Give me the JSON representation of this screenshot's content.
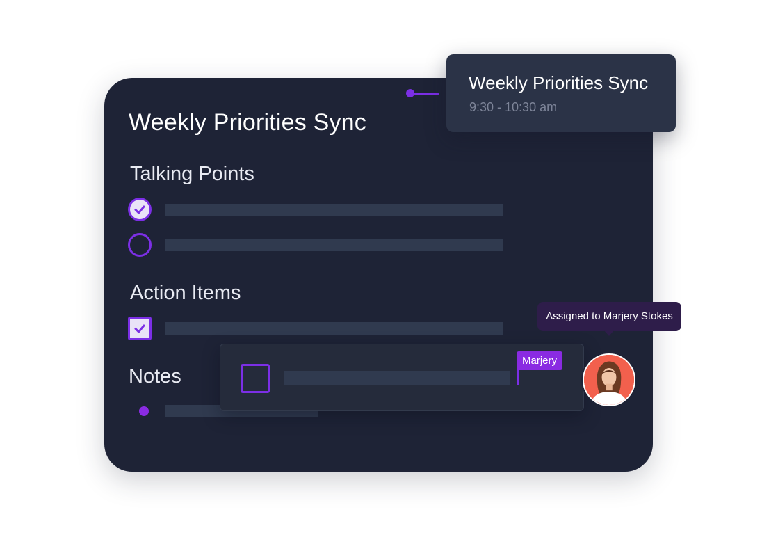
{
  "meeting": {
    "title": "Weekly Priorities Sync"
  },
  "sections": {
    "talking_points": "Talking Points",
    "action_items": "Action Items",
    "notes": "Notes"
  },
  "talking_points_items": [
    {
      "checked": true
    },
    {
      "checked": false
    }
  ],
  "action_items_list": [
    {
      "checked": true
    }
  ],
  "popup": {
    "title": "Weekly Priorities Sync",
    "time": "9:30 - 10:30 am"
  },
  "editor": {
    "cursor_label": "Marjery"
  },
  "assignment": {
    "tooltip": "Assigned to Marjery Stokes"
  },
  "colors": {
    "accent": "#7c2fe6",
    "card_bg": "#1e2336",
    "popup_bg": "#2b3347",
    "tooltip_bg": "#2e1d4a",
    "avatar_bg": "#f2604d"
  },
  "icons": {
    "check": "check-icon",
    "avatar": "user-avatar"
  }
}
